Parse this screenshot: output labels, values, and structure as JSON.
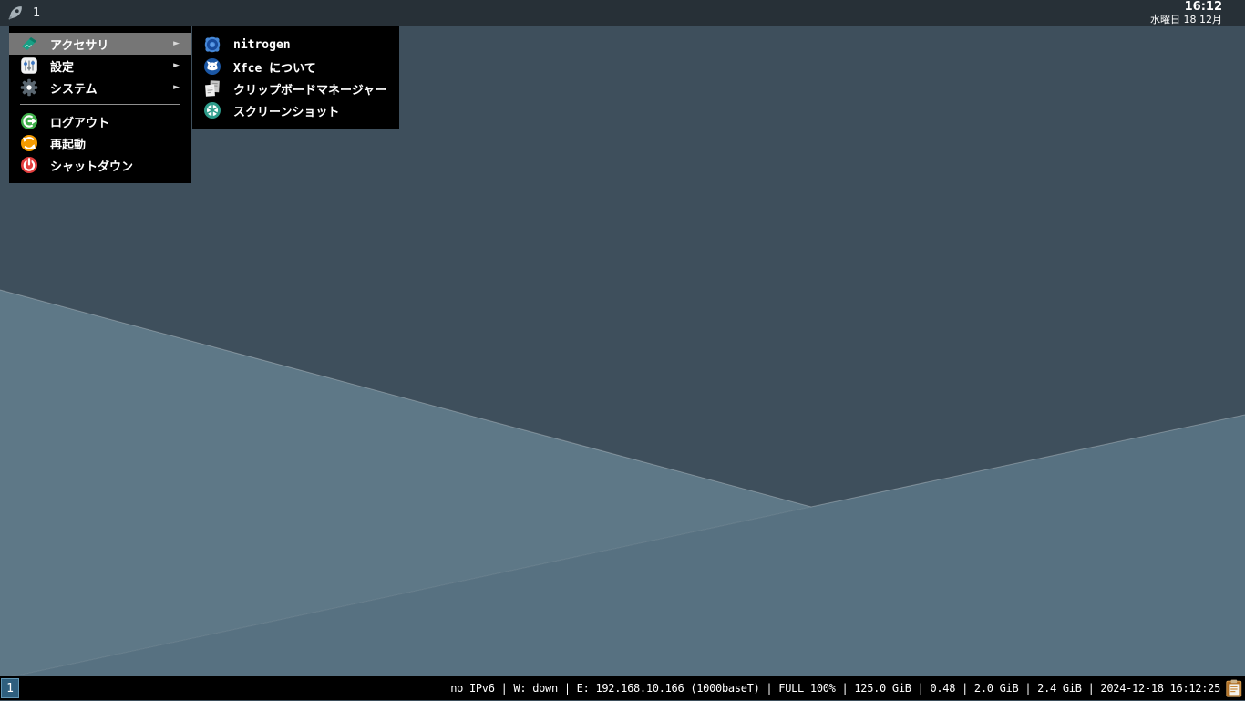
{
  "panel": {
    "workspace_label": "1",
    "clock": {
      "time": "16:12",
      "date": "水曜日 18 12月"
    }
  },
  "menu": {
    "submenu_arrow": "►",
    "items": [
      {
        "label": "アクセサリ",
        "icon": "accessories-icon",
        "has_submenu": true,
        "selected": true
      },
      {
        "label": "設定",
        "icon": "settings-icon",
        "has_submenu": true
      },
      {
        "label": "システム",
        "icon": "system-gear-icon",
        "has_submenu": true
      },
      {
        "label": "ログアウト",
        "icon": "logout-icon"
      },
      {
        "label": "再起動",
        "icon": "restart-icon"
      },
      {
        "label": "シャットダウン",
        "icon": "shutdown-icon"
      }
    ]
  },
  "submenu": {
    "items": [
      {
        "label": "nitrogen",
        "icon": "nitrogen-icon"
      },
      {
        "label": "Xfce について",
        "icon": "xfce-about-icon"
      },
      {
        "label": "クリップボードマネージャー",
        "icon": "clipboard-manager-icon"
      },
      {
        "label": "スクリーンショット",
        "icon": "screenshot-icon"
      }
    ]
  },
  "statusbar": {
    "workspace": "1",
    "status_text": "no IPv6 | W: down | E: 192.168.10.166 (1000baseT) | FULL 100% | 125.0 GiB | 0.48 | 2.0 GiB | 2.4 GiB | 2024-12-18 16:12:25",
    "tray_icon": "clipboard-tray-icon"
  },
  "icons": {
    "launcher": "rocket-icon"
  },
  "colors": {
    "panel_bg": "#273037",
    "menu_bg": "#000000",
    "menu_highlight": "#767676",
    "wallpaper_dark": "#3e4f5c",
    "wallpaper_mid": "#5e7887",
    "wallpaper_light": "#577181",
    "workspace_box_bg": "#2f5f7e",
    "workspace_box_border": "#6296b4",
    "logout_green": "#3fae49",
    "restart_orange": "#f59b00",
    "shutdown_red": "#e33e3e",
    "accessories_teal": "#16a085",
    "screenshot_teal": "#2d9b8a",
    "nitrogen_blue": "#4587d7",
    "xfce_blue": "#1b57a5"
  }
}
